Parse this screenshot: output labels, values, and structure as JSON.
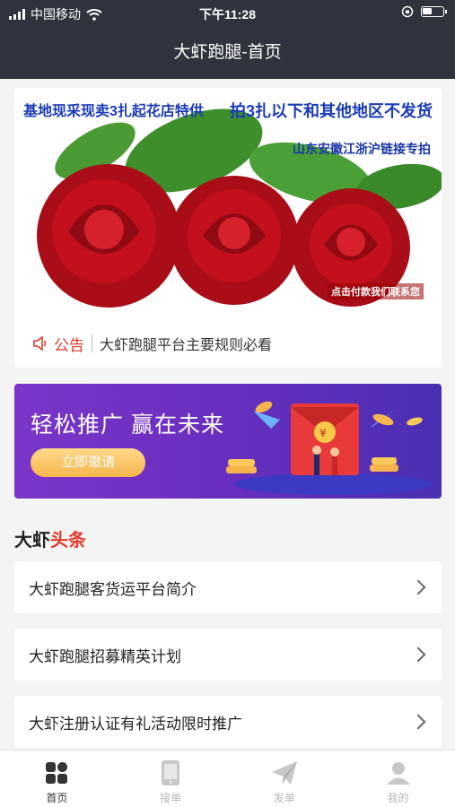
{
  "status_bar": {
    "carrier": "中国移动",
    "time": "下午11:28"
  },
  "nav": {
    "title": "大虾跑腿-首页"
  },
  "banner": {
    "line1": "基地现采现卖3扎起花店特供",
    "line2": "拍3扎以下和其他地区不发货",
    "line3": "山东安徽江浙沪链接专拍",
    "line4": "点击付款我们联系您",
    "rose_color": "#c4101c"
  },
  "notice": {
    "icon": "speaker-icon",
    "label": "公告",
    "text": "大虾跑腿平台主要规则必看"
  },
  "promo": {
    "title": "轻松推广 赢在未来",
    "button": "立即邀请"
  },
  "section": {
    "title_part1": "大虾",
    "title_part2": "头条"
  },
  "news": [
    {
      "text": "大虾跑腿客货运平台简介"
    },
    {
      "text": "大虾跑腿招募精英计划"
    },
    {
      "text": "大虾注册认证有礼活动限时推广"
    }
  ],
  "tabs": [
    {
      "label": "首页",
      "icon": "home-grid-icon",
      "active": true
    },
    {
      "label": "接单",
      "icon": "phone-icon",
      "active": false
    },
    {
      "label": "发单",
      "icon": "send-icon",
      "active": false
    },
    {
      "label": "我的",
      "icon": "user-icon",
      "active": false
    }
  ],
  "colors": {
    "header_bg": "#2e333d",
    "accent_red": "#e13a2b",
    "promo_purple": "#6a2fc0",
    "promo_button": "#f6b54c"
  }
}
